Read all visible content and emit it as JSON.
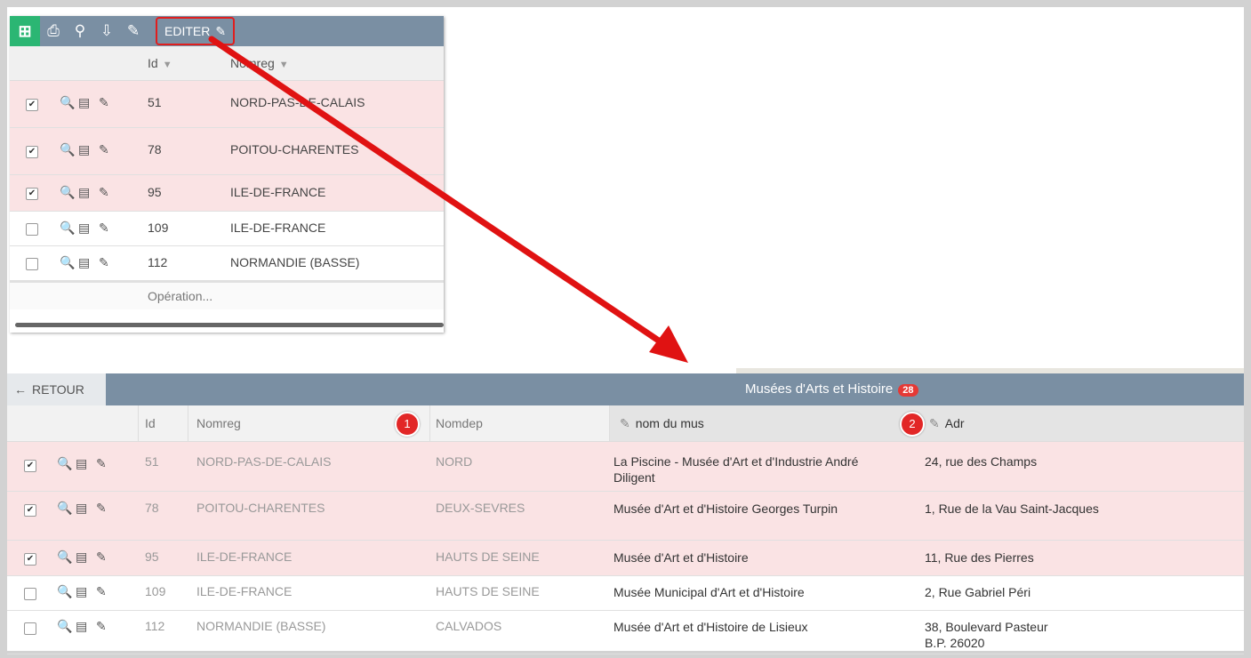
{
  "top_grid": {
    "toolbar": {
      "add_icon": "add-row-icon",
      "print_icon": "printer-icon",
      "search_icon": "search-edit-icon",
      "export_icon": "export-icon",
      "edit_icon": "edit-rows-icon",
      "edit_label": "EDITER"
    },
    "headers": {
      "id": "Id",
      "nomreg": "Nomreg"
    },
    "rows": [
      {
        "checked": "✔",
        "id": "51",
        "nomreg": "NORD-PAS-DE-CALAIS"
      },
      {
        "checked": "✔",
        "id": "78",
        "nomreg": "POITOU-CHARENTES"
      },
      {
        "checked": "✔",
        "id": "95",
        "nomreg": "ILE-DE-FRANCE"
      },
      {
        "checked": "",
        "id": "109",
        "nomreg": "ILE-DE-FRANCE"
      },
      {
        "checked": "",
        "id": "112",
        "nomreg": "NORMANDIE (BASSE)"
      }
    ],
    "operation_label": "Opération..."
  },
  "bottom_grid": {
    "back_label": "RETOUR",
    "title": "Musées d'Arts et Histoire",
    "count_badge": "28",
    "headers": {
      "id": "Id",
      "nomreg": "Nomreg",
      "nomdep": "Nomdep",
      "nom_mus": "nom du mus",
      "adr": "Adr"
    },
    "markers": {
      "one": "1",
      "two": "2"
    },
    "rows": [
      {
        "checked": "✔",
        "id": "51",
        "nomreg": "NORD-PAS-DE-CALAIS",
        "nomdep": "NORD",
        "nom_mus_1": "La Piscine - Musée d'Art et d'Industrie André",
        "nom_mus_2": "Diligent",
        "adr_1": "24, rue des Champs",
        "adr_2": ""
      },
      {
        "checked": "✔",
        "id": "78",
        "nomreg": "POITOU-CHARENTES",
        "nomdep": "DEUX-SEVRES",
        "nom_mus_1": "Musée d'Art et d'Histoire Georges Turpin",
        "nom_mus_2": "",
        "adr_1": "1, Rue de la Vau Saint-Jacques",
        "adr_2": ""
      },
      {
        "checked": "✔",
        "id": "95",
        "nomreg": "ILE-DE-FRANCE",
        "nomdep": "HAUTS DE SEINE",
        "nom_mus_1": "Musée d'Art et d'Histoire",
        "nom_mus_2": "",
        "adr_1": "11, Rue des Pierres",
        "adr_2": ""
      },
      {
        "checked": "",
        "id": "109",
        "nomreg": "ILE-DE-FRANCE",
        "nomdep": "HAUTS DE SEINE",
        "nom_mus_1": "Musée Municipal d'Art et d'Histoire",
        "nom_mus_2": "",
        "adr_1": "2, Rue Gabriel Péri",
        "adr_2": ""
      },
      {
        "checked": "",
        "id": "112",
        "nomreg": "NORMANDIE (BASSE)",
        "nomdep": "CALVADOS",
        "nom_mus_1": "Musée d'Art et d'Histoire de Lisieux",
        "nom_mus_2": "",
        "adr_1": "38, Boulevard Pasteur",
        "adr_2": "B.P. 26020"
      }
    ]
  },
  "colors": {
    "toolbar": "#7a8fa3",
    "selected_row": "#fae3e4",
    "add_button": "#2bb673",
    "highlight": "#e01e1e"
  }
}
